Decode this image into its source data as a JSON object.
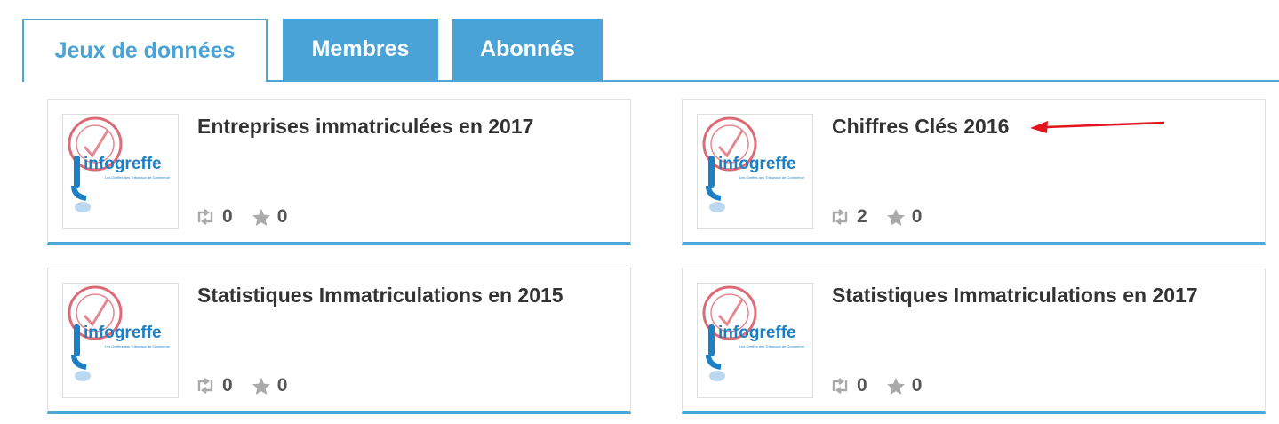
{
  "tabs": [
    {
      "label": "Jeux de données",
      "active": true
    },
    {
      "label": "Membres",
      "active": false
    },
    {
      "label": "Abonnés",
      "active": false
    }
  ],
  "logo": {
    "text": "infogreffe",
    "tagline": "Les Greffes des Tribunaux de Commerce",
    "stamp_text": "PRODUCTEUR CERTIFIÉ",
    "colors": {
      "brand": "#1d7fc4",
      "stamp": "#d23a4a"
    }
  },
  "datasets": [
    {
      "title": "Entreprises immatriculées en 2017",
      "reuses": "0",
      "stars": "0"
    },
    {
      "title": "Chiffres Clés 2016",
      "reuses": "2",
      "stars": "0"
    },
    {
      "title": "Statistiques Immatriculations en 2015",
      "reuses": "0",
      "stars": "0"
    },
    {
      "title": "Statistiques Immatriculations en 2017",
      "reuses": "0",
      "stars": "0"
    }
  ],
  "annotation": {
    "type": "arrow",
    "color": "#e3141c",
    "points_to": "Chiffres Clés 2016"
  },
  "icons": {
    "reuse": "retweet-icon",
    "star": "star-icon"
  },
  "colors": {
    "accent": "#4aa3d6",
    "text": "#333333",
    "muted": "#aaaaaa"
  }
}
